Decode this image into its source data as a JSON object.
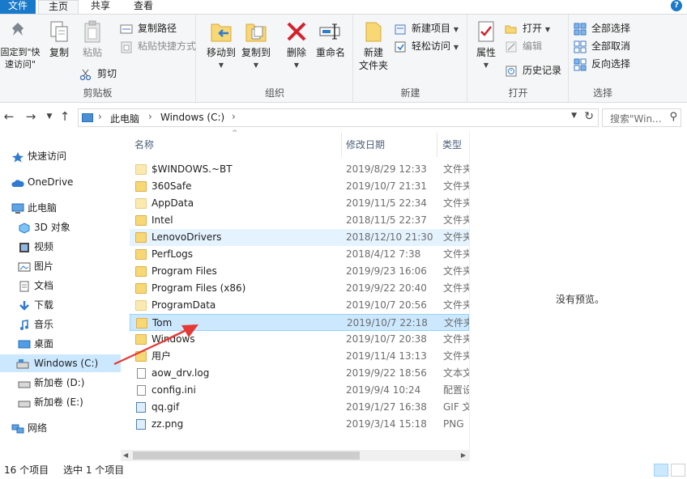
{
  "tabs": {
    "file": "文件",
    "home": "主页",
    "share": "共享",
    "view": "查看",
    "help": "?"
  },
  "ribbon": {
    "clipboard": {
      "title": "剪贴板",
      "pin": "固定到\"快\n速访问\"",
      "copy": "复制",
      "paste": "粘贴",
      "copy_path": "复制路径",
      "paste_shortcut": "粘贴快捷方式",
      "cut": "剪切"
    },
    "organize": {
      "title": "组织",
      "move_to": "移动到",
      "copy_to": "复制到",
      "delete": "删除",
      "rename": "重命名"
    },
    "new": {
      "title": "新建",
      "new_folder": "新建\n文件夹",
      "new_item": "新建项目",
      "easy_access": "轻松访问"
    },
    "open": {
      "title": "打开",
      "properties": "属性",
      "open": "打开",
      "edit": "编辑",
      "history": "历史记录"
    },
    "select": {
      "title": "选择",
      "select_all": "全部选择",
      "select_none": "全部取消",
      "invert": "反向选择"
    }
  },
  "address": {
    "crumbs": [
      "此电脑",
      "Windows (C:)"
    ],
    "search_placeholder": "搜索\"Win...",
    "back": "←",
    "forward": "→",
    "up": "↑",
    "refresh": "↻"
  },
  "nav": {
    "quick_access": "快速访问",
    "onedrive": "OneDrive",
    "this_pc": "此电脑",
    "items": [
      "3D 对象",
      "视频",
      "图片",
      "文档",
      "下载",
      "音乐",
      "桌面"
    ],
    "drives": [
      "Windows (C:)",
      "新加卷 (D:)",
      "新加卷 (E:)"
    ],
    "network": "网络"
  },
  "columns": {
    "name": "名称",
    "date": "修改日期",
    "type": "类型"
  },
  "files": [
    {
      "name": "$WINDOWS.~BT",
      "date": "2019/8/29 12:33",
      "type": "文件夹",
      "icon": "folder-light"
    },
    {
      "name": "360Safe",
      "date": "2019/10/7 21:31",
      "type": "文件夹",
      "icon": "folder"
    },
    {
      "name": "AppData",
      "date": "2019/11/5 22:34",
      "type": "文件夹",
      "icon": "folder-light"
    },
    {
      "name": "Intel",
      "date": "2018/11/5 22:37",
      "type": "文件夹",
      "icon": "folder"
    },
    {
      "name": "LenovoDrivers",
      "date": "2018/12/10 21:30",
      "type": "文件夹",
      "icon": "folder"
    },
    {
      "name": "PerfLogs",
      "date": "2018/4/12 7:38",
      "type": "文件夹",
      "icon": "folder"
    },
    {
      "name": "Program Files",
      "date": "2019/9/23 16:06",
      "type": "文件夹",
      "icon": "folder"
    },
    {
      "name": "Program Files (x86)",
      "date": "2019/9/22 20:40",
      "type": "文件夹",
      "icon": "folder"
    },
    {
      "name": "ProgramData",
      "date": "2019/10/7 20:56",
      "type": "文件夹",
      "icon": "folder-light"
    },
    {
      "name": "Tom",
      "date": "2019/10/7 22:18",
      "type": "文件夹",
      "icon": "folder"
    },
    {
      "name": "Windows",
      "date": "2019/10/7 20:38",
      "type": "文件夹",
      "icon": "folder"
    },
    {
      "name": "用户",
      "date": "2019/11/4 13:13",
      "type": "文件夹",
      "icon": "folder"
    },
    {
      "name": "aow_drv.log",
      "date": "2019/9/22 18:56",
      "type": "文本文档",
      "icon": "file"
    },
    {
      "name": "config.ini",
      "date": "2019/9/4 10:24",
      "type": "配置设置",
      "icon": "file"
    },
    {
      "name": "qq.gif",
      "date": "2019/1/27 16:38",
      "type": "GIF 文件",
      "icon": "img"
    },
    {
      "name": "zz.png",
      "date": "2019/3/14 15:18",
      "type": "PNG",
      "icon": "img"
    }
  ],
  "preview": {
    "message": "没有预览。"
  },
  "status": {
    "count": "16 个项目",
    "selected": "选中 1 个项目"
  },
  "colors": {
    "accent": "#1979ca",
    "selected": "#cce8ff",
    "hover": "#e5f3ff",
    "arrow": "#e53935"
  }
}
